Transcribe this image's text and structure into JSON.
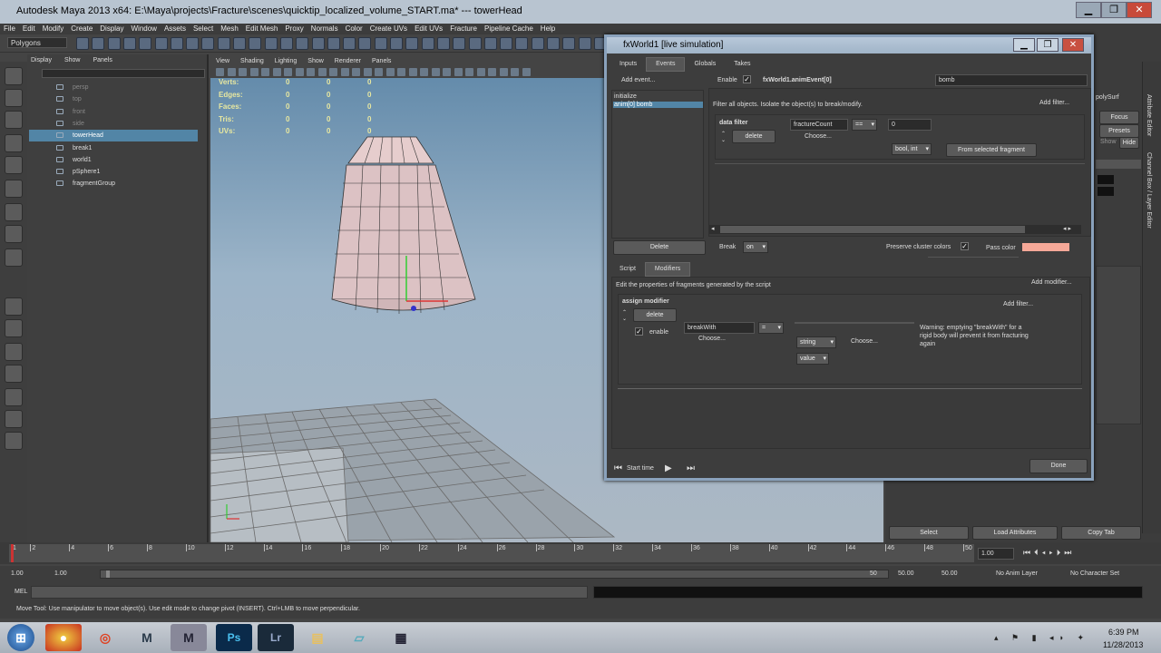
{
  "window": {
    "title": "Autodesk Maya 2013 x64: E:\\Maya\\projects\\Fracture\\scenes\\quicktip_localized_volume_START.ma*   ---   towerHead"
  },
  "menu": [
    "File",
    "Edit",
    "Modify",
    "Create",
    "Display",
    "Window",
    "Assets",
    "Select",
    "Mesh",
    "Edit Mesh",
    "Proxy",
    "Normals",
    "Color",
    "Create UVs",
    "Edit UVs",
    "Fracture",
    "Pipeline Cache",
    "Help"
  ],
  "toolbar": {
    "mode": "Polygons"
  },
  "outliner": {
    "menu": [
      "Display",
      "Show",
      "Panels"
    ],
    "items": [
      {
        "label": "persp",
        "dim": true
      },
      {
        "label": "top",
        "dim": true
      },
      {
        "label": "front",
        "dim": true
      },
      {
        "label": "side",
        "dim": true
      },
      {
        "label": "towerHead",
        "selected": true
      },
      {
        "label": "break1"
      },
      {
        "label": "world1"
      },
      {
        "label": "pSphere1"
      },
      {
        "label": "fragmentGroup"
      }
    ]
  },
  "viewport": {
    "menu": [
      "View",
      "Shading",
      "Lighting",
      "Show",
      "Renderer",
      "Panels"
    ],
    "hud": [
      {
        "label": "Verts:",
        "values": [
          "0",
          "0",
          "0"
        ]
      },
      {
        "label": "Edges:",
        "values": [
          "0",
          "0",
          "0"
        ]
      },
      {
        "label": "Faces:",
        "values": [
          "0",
          "0",
          "0"
        ]
      },
      {
        "label": "Tris:",
        "values": [
          "0",
          "0",
          "0"
        ]
      },
      {
        "label": "UVs:",
        "values": [
          "0",
          "0",
          "0"
        ]
      }
    ]
  },
  "dialog": {
    "title": "fxWorld1   [live simulation]",
    "tabs": [
      "Inputs",
      "Events",
      "Globals",
      "Takes"
    ],
    "active_tab": "Events",
    "add_event": "Add event...",
    "events": [
      "initialize",
      "anim[0] bomb"
    ],
    "delete_label": "Delete",
    "enable_label": "Enable",
    "event_name": "fxWorld1.animEvent[0]",
    "event_value": "bomb",
    "filter_desc": "Filter all objects. Isolate the object(s) to break/modify.",
    "add_filter": "Add filter...",
    "data_filter": {
      "title": "data filter",
      "delete": "delete",
      "attr": "fractureCount",
      "op": "==",
      "value": "0",
      "choose": "Choose...",
      "type": "bool, int",
      "from_selected": "From selected fragment"
    },
    "break_label": "Break",
    "break_value": "on",
    "preserve_label": "Preserve cluster colors",
    "pass_color_label": "Pass color",
    "pass_color": "#f6a898",
    "sub_tabs": [
      "Script",
      "Modifiers"
    ],
    "sub_active": "Modifiers",
    "modifiers_desc": "Edit the properties of fragments generated by the script",
    "add_modifier": "Add modifier...",
    "assign": {
      "title": "assign modifier",
      "delete": "delete",
      "enable": "enable",
      "attr": "breakWith",
      "op": "=",
      "choose": "Choose...",
      "type1": "string",
      "type2": "value",
      "choose2": "Choose...",
      "add_filter": "Add filter...",
      "warning": "Warning: emptying \"breakWith\" for a rigid body will prevent it from fracturing again"
    },
    "start_time": "Start time",
    "done": "Done"
  },
  "rightpanel": {
    "partial_label": "polySurf",
    "buttons": [
      "Focus",
      "Presets"
    ],
    "show_hide": [
      "Show",
      "Hide"
    ],
    "bottom_buttons": [
      "Select",
      "Load Attributes",
      "Copy Tab"
    ],
    "side_tabs": [
      "Attribute Editor",
      "Channel Box / Layer Editor"
    ]
  },
  "timeline": {
    "ticks": [
      "1",
      "2",
      "4",
      "6",
      "8",
      "10",
      "12",
      "14",
      "16",
      "18",
      "20",
      "22",
      "24",
      "26",
      "28",
      "30",
      "32",
      "34",
      "36",
      "38",
      "40",
      "42",
      "44",
      "46",
      "48",
      "50"
    ],
    "current": "1.00",
    "range_start": "1.00",
    "range_inner_start": "1.00",
    "range_slider_end": "50",
    "range_inner_end": "50.00",
    "range_end": "50.00",
    "anim_layer": "No Anim Layer",
    "char_set": "No Character Set"
  },
  "cmdline": {
    "label": "MEL"
  },
  "help": "Move Tool: Use manipulator to move object(s). Use edit mode to change pivot (INSERT).  Ctrl+LMB to move perpendicular.",
  "taskbar": {
    "time": "6:39 PM",
    "date": "11/28/2013"
  }
}
